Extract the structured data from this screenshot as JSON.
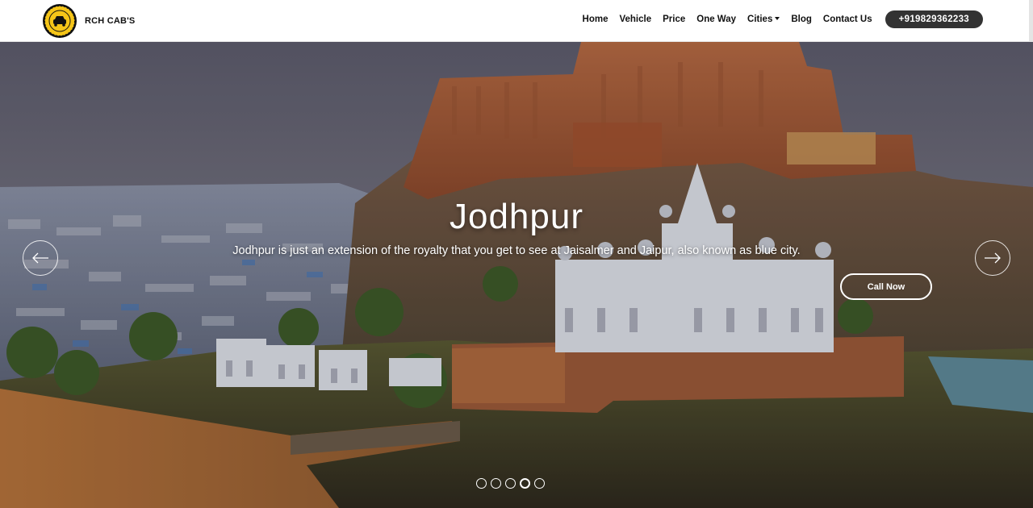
{
  "brand": {
    "name": "RCH CAB'S",
    "logo_icon": "taxi-badge-icon"
  },
  "nav": {
    "items": [
      "Home",
      "Vehicle",
      "Price",
      "One Way",
      "Cities",
      "Blog",
      "Contact Us"
    ],
    "phone": "+919829362233"
  },
  "hero": {
    "title": "Jodhpur",
    "subtitle": "Jodhpur is just an extension of the royalty that you get to see at Jaisalmer and Jaipur, also known as blue city.",
    "cta": "Call Now",
    "slide_count": 5,
    "active_slide": 4
  },
  "colors": {
    "accent_yellow": "#f5c518",
    "button_dark": "#333333"
  }
}
